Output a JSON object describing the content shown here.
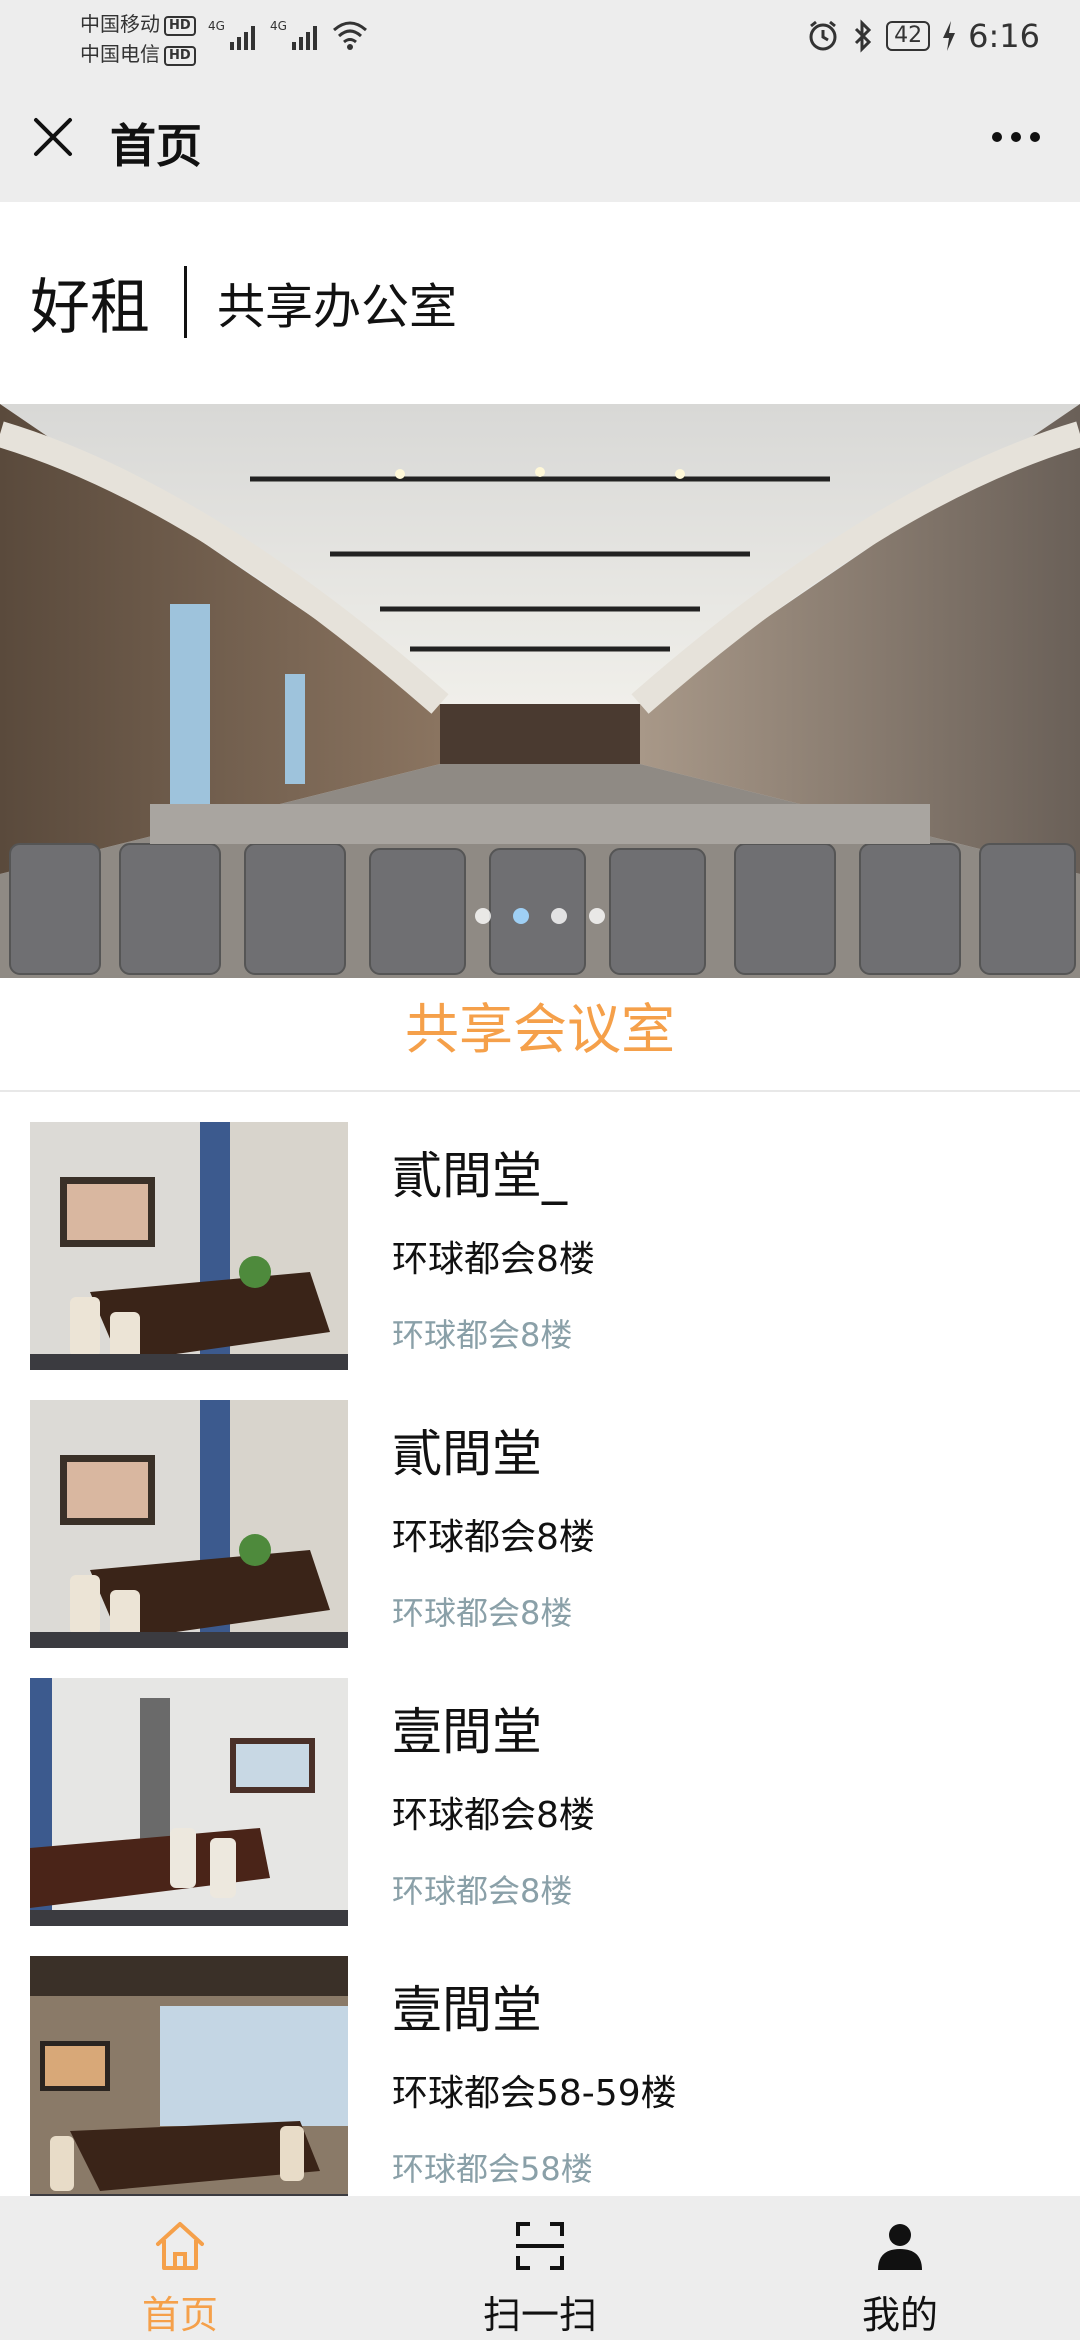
{
  "status_bar": {
    "carrier1": "中国移动",
    "carrier2": "中国电信",
    "hd": "HD",
    "net": "4G",
    "battery": "42",
    "time": "6:16",
    "icons": [
      "signal-icon",
      "wifi-icon",
      "alarm-icon",
      "bluetooth-icon",
      "battery-icon",
      "charging-icon"
    ]
  },
  "header": {
    "title": "首页",
    "close_icon": "close-icon",
    "more_icon": "more-icon"
  },
  "brand": {
    "name": "好租",
    "subtitle": "共享办公室"
  },
  "banner": {
    "slide_count": 4,
    "active_index": 1
  },
  "section": {
    "title": "共享会议室"
  },
  "rooms": [
    {
      "name": "貳間堂_",
      "location": "环球都会8楼",
      "floor": "环球都会8楼"
    },
    {
      "name": "貳間堂",
      "location": "环球都会8楼",
      "floor": "环球都会8楼"
    },
    {
      "name": "壹間堂",
      "location": "环球都会8楼",
      "floor": "环球都会8楼"
    },
    {
      "name": "壹間堂",
      "location": "环球都会58-59楼",
      "floor": "环球都会58楼"
    }
  ],
  "tabs": [
    {
      "label": "首页",
      "icon": "home-icon",
      "active": true
    },
    {
      "label": "扫一扫",
      "icon": "scan-icon",
      "active": false
    },
    {
      "label": "我的",
      "icon": "user-icon",
      "active": false
    }
  ],
  "colors": {
    "accent": "#f5a04a",
    "bar_bg": "#ededed",
    "muted_text": "#8aa0a8",
    "dot_active": "#9fd0f5"
  }
}
